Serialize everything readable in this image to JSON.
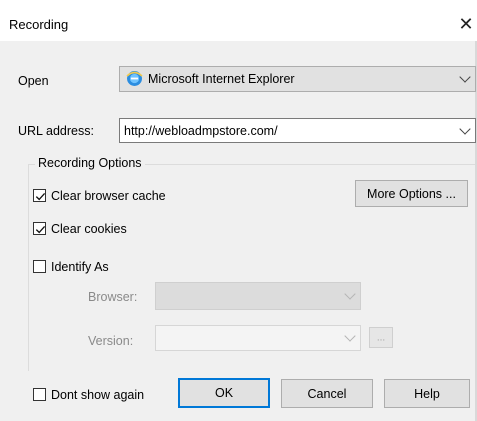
{
  "dialog": {
    "title": "Recording",
    "close_glyph": "✕"
  },
  "open": {
    "label": "Open",
    "browser": "Microsoft Internet Explorer",
    "browser_icon": "internet-explorer-icon"
  },
  "url": {
    "label": "URL address:",
    "value": "http://webloadmpstore.com/"
  },
  "options": {
    "group_label": "Recording Options",
    "clear_cache": {
      "label": "Clear browser cache",
      "checked": true
    },
    "clear_cookies": {
      "label": "Clear cookies",
      "checked": true
    },
    "identify_as": {
      "label": "Identify As",
      "checked": false
    },
    "more_options": "More Options ...",
    "browser_label": "Browser:",
    "browser_value": "",
    "version_label": "Version:",
    "version_value": "",
    "version_browse": "..."
  },
  "footer": {
    "dont_show": {
      "label": "Dont show again",
      "checked": false
    },
    "ok": "OK",
    "cancel": "Cancel",
    "help": "Help"
  },
  "colors": {
    "accent": "#0078d7",
    "background": "#f0f0f0"
  }
}
